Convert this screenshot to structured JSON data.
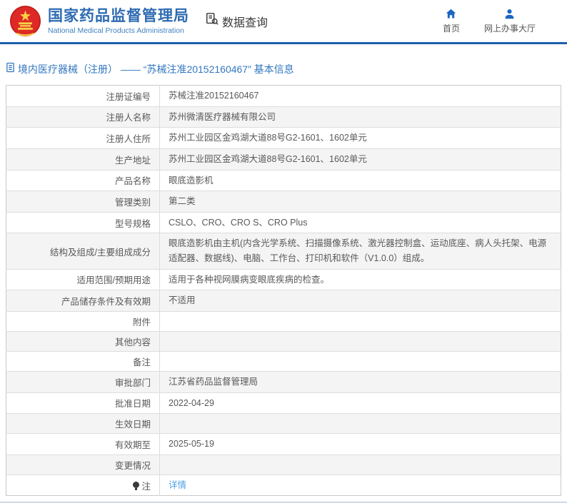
{
  "header": {
    "agency_cn": "国家药品监督管理局",
    "agency_en": "National Medical Products Administration",
    "section_label": "数据查询",
    "nav": [
      {
        "label": "首页",
        "icon": "home-icon"
      },
      {
        "label": "网上办事大厅",
        "icon": "person-icon"
      }
    ]
  },
  "breadcrumb": "境内医疗器械（注册） —— “苏械注准20152160467” 基本信息",
  "table": {
    "rows": [
      {
        "label": "注册证编号",
        "value": "苏械注准20152160467"
      },
      {
        "label": "注册人名称",
        "value": "苏州微清医疗器械有限公司"
      },
      {
        "label": "注册人住所",
        "value": "苏州工业园区金鸡湖大道88号G2-1601、1602单元"
      },
      {
        "label": "生产地址",
        "value": "苏州工业园区金鸡湖大道88号G2-1601、1602单元"
      },
      {
        "label": "产品名称",
        "value": "眼底造影机"
      },
      {
        "label": "管理类别",
        "value": "第二类"
      },
      {
        "label": "型号规格",
        "value": "CSLO、CRO、CRO S、CRO Plus"
      },
      {
        "label": "结构及组成/主要组成成分",
        "value": "眼底造影机由主机(内含光学系统、扫描摄像系统、激光器控制盒、运动底座、病人头托架、电源适配器、数据线)、电脑、工作台、打印机和软件（V1.0.0）组成。"
      },
      {
        "label": "适用范围/预期用途",
        "value": "适用于各种视网膜病变眼底疾病的检查。"
      },
      {
        "label": "产品储存条件及有效期",
        "value": "不适用"
      },
      {
        "label": "附件",
        "value": ""
      },
      {
        "label": "其他内容",
        "value": ""
      },
      {
        "label": "备注",
        "value": ""
      },
      {
        "label": "审批部门",
        "value": "江苏省药品监督管理局"
      },
      {
        "label": "批准日期",
        "value": "2022-04-29"
      },
      {
        "label": "生效日期",
        "value": ""
      },
      {
        "label": "有效期至",
        "value": "2025-05-19"
      },
      {
        "label": "变更情况",
        "value": ""
      },
      {
        "label": "注",
        "value": "详情",
        "link": true,
        "icon": "bulb-icon"
      }
    ]
  },
  "colors": {
    "accent_blue": "#2d6bb2",
    "nav_icon_blue": "#1a66c2",
    "breadcrumb_blue": "#3377c0",
    "link_blue": "#4d9fea",
    "header_line_blue": "#1b5fab",
    "row_alt_gray": "#f4f4f4",
    "table_border": "#dddddd",
    "emblem_red": "#de2a26",
    "emblem_gold": "#f7d247"
  }
}
